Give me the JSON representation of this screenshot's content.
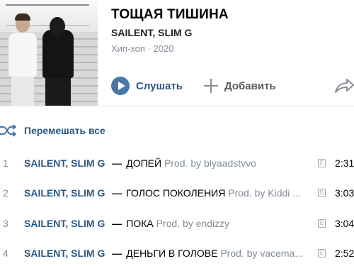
{
  "album": {
    "title": "ТОЩАЯ ТИШИНА",
    "artists": "SAILENT, SLIM G",
    "genre": "Хип-хоп",
    "separator": "·",
    "year": "2020",
    "cover_icon": "album-cover-photo"
  },
  "actions": {
    "listen_label": "Слушать",
    "add_label": "Добавить",
    "shuffle_label": "Перемешать все",
    "icons": [
      "play-icon",
      "plus-icon",
      "share-icon",
      "shuffle-icon"
    ]
  },
  "colors": {
    "accent": "#4a76a8",
    "link": "#2a5885",
    "secondary": "#818c99"
  },
  "tracks": [
    {
      "num": "1",
      "artist1": "SAILENT",
      "comma": ",",
      "artist2": "SLIM G",
      "dash": "—",
      "title": "ДОПЕЙ",
      "prod": "Prod. by blyaadstvvo",
      "explicit": "E",
      "duration": "2:31"
    },
    {
      "num": "2",
      "artist1": "SAILENT",
      "comma": ",",
      "artist2": "SLIM G",
      "dash": "—",
      "title": "ГОЛОС ПОКОЛЕНИЯ",
      "prod": "Prod. by Kiddi ...",
      "explicit": "E",
      "duration": "3:03"
    },
    {
      "num": "3",
      "artist1": "SAILENT",
      "comma": ",",
      "artist2": "SLIM G",
      "dash": "—",
      "title": "ПОКА",
      "prod": "Prod. by endizzy",
      "explicit": "E",
      "duration": "3:04"
    },
    {
      "num": "4",
      "artist1": "SAILENT",
      "comma": ",",
      "artist2": "SLIM G",
      "dash": "—",
      "title": "ДЕНЬГИ В ГОЛОВЕ",
      "prod": "Prod. by vacema...",
      "explicit": "E",
      "duration": "2:52"
    }
  ]
}
